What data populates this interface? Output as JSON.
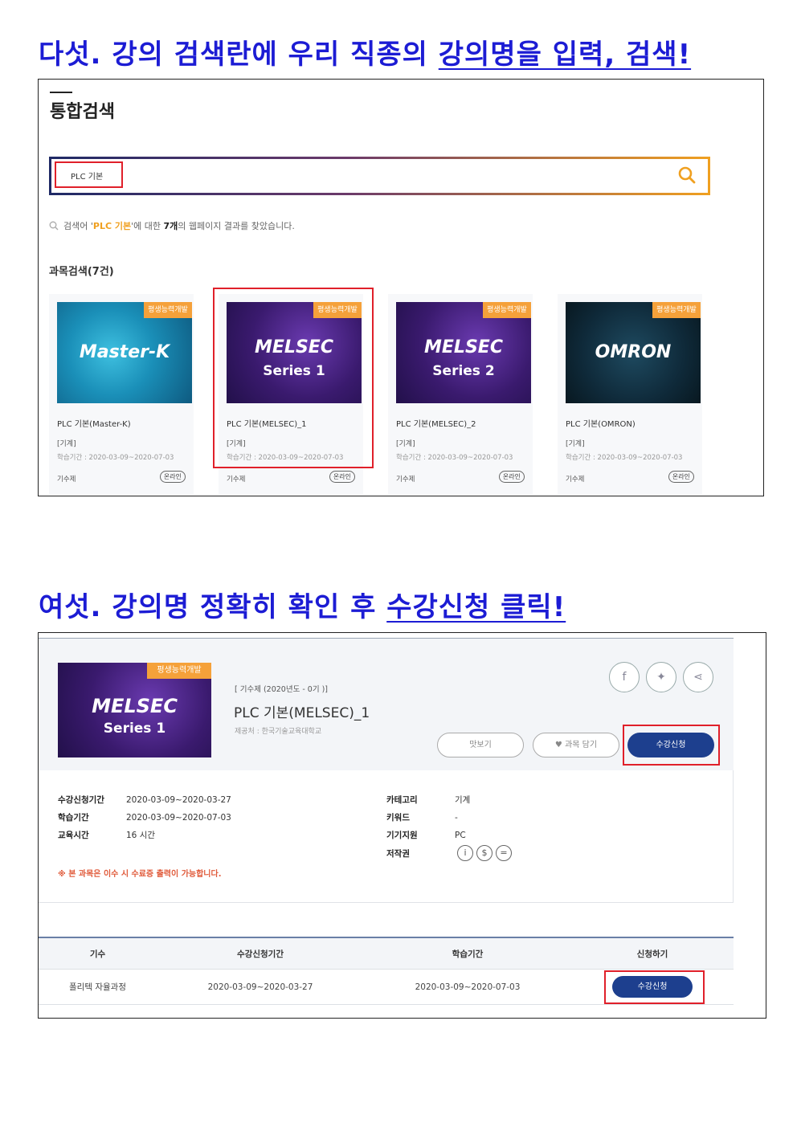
{
  "step5": {
    "heading_plain": "다섯. 강의 검색란에 우리 직종의 ",
    "heading_underlined": "강의명을 입력, 검색!"
  },
  "search_page": {
    "title": "통합검색",
    "search_value": "PLC 기본",
    "result_prefix": "검색어 '",
    "result_keyword": "PLC 기본",
    "result_mid": "'에 대한 ",
    "result_count": "7개",
    "result_suffix": "의 웹페이지 결과를 찾았습니다.",
    "subject_heading": "과목검색(7건)",
    "cards": [
      {
        "badge": "평생능력개발",
        "thumb_title": "Master-K",
        "thumb_sub": "",
        "name": "PLC 기본(Master-K)",
        "category": "[기계]",
        "period": "학습기간 : 2020-03-09~2020-07-03",
        "type": "기수제",
        "mode": "온라인",
        "bg": "#1a8fb8"
      },
      {
        "badge": "평생능력개발",
        "thumb_title": "MELSEC",
        "thumb_sub": "Series 1",
        "name": "PLC 기본(MELSEC)_1",
        "category": "[기계]",
        "period": "학습기간 : 2020-03-09~2020-07-03",
        "type": "기수제",
        "mode": "온라인",
        "bg": "#3a1a6e"
      },
      {
        "badge": "평생능력개발",
        "thumb_title": "MELSEC",
        "thumb_sub": "Series 2",
        "name": "PLC 기본(MELSEC)_2",
        "category": "[기계]",
        "period": "학습기간 : 2020-03-09~2020-07-03",
        "type": "기수제",
        "mode": "온라인",
        "bg": "#3a1a6e"
      },
      {
        "badge": "평생능력개발",
        "thumb_title": "OMRON",
        "thumb_sub": "",
        "name": "PLC 기본(OMRON)",
        "category": "[기계]",
        "period": "학습기간 : 2020-03-09~2020-07-03",
        "type": "기수제",
        "mode": "온라인",
        "bg": "#0f2a3a"
      }
    ]
  },
  "step6": {
    "heading_plain": "여섯. 강의명 정확히 확인 후 ",
    "heading_underlined": "수강신청 클릭!"
  },
  "course_detail": {
    "badge": "평생능력개발",
    "thumb_title": "MELSEC",
    "thumb_sub": "Series 1",
    "class_info": "[ 기수제 (2020년도 - 0기 )]",
    "course_name": "PLC 기본(MELSEC)_1",
    "provider": "제공처 : 한국기술교육대학교",
    "preview_label": "맛보기",
    "wishlist_label": "과목 담기",
    "enroll_label": "수강신청",
    "info_left": [
      {
        "label": "수강신청기간",
        "value": "2020-03-09~2020-03-27"
      },
      {
        "label": "학습기간",
        "value": "2020-03-09~2020-07-03"
      },
      {
        "label": "교육시간",
        "value": "16 시간"
      }
    ],
    "info_right": [
      {
        "label": "카테고리",
        "value": "기계"
      },
      {
        "label": "키워드",
        "value": "-"
      },
      {
        "label": "기기지원",
        "value": "PC"
      },
      {
        "label": "저작권",
        "value": ""
      }
    ],
    "note": "※ 본 과목은 이수 시 수료증 출력이 가능합니다.",
    "table": {
      "headers": [
        "기수",
        "수강신청기간",
        "학습기간",
        "신청하기"
      ],
      "rows": [
        {
          "cohort": "폴리텍 자율과정",
          "apply_period": "2020-03-09~2020-03-27",
          "study_period": "2020-03-09~2020-07-03",
          "action": "수강신청"
        }
      ]
    }
  },
  "colors": {
    "heading": "#1c1cd4",
    "highlight": "#e0202a",
    "badge": "#f5a13a",
    "primary": "#1d3f8e"
  }
}
